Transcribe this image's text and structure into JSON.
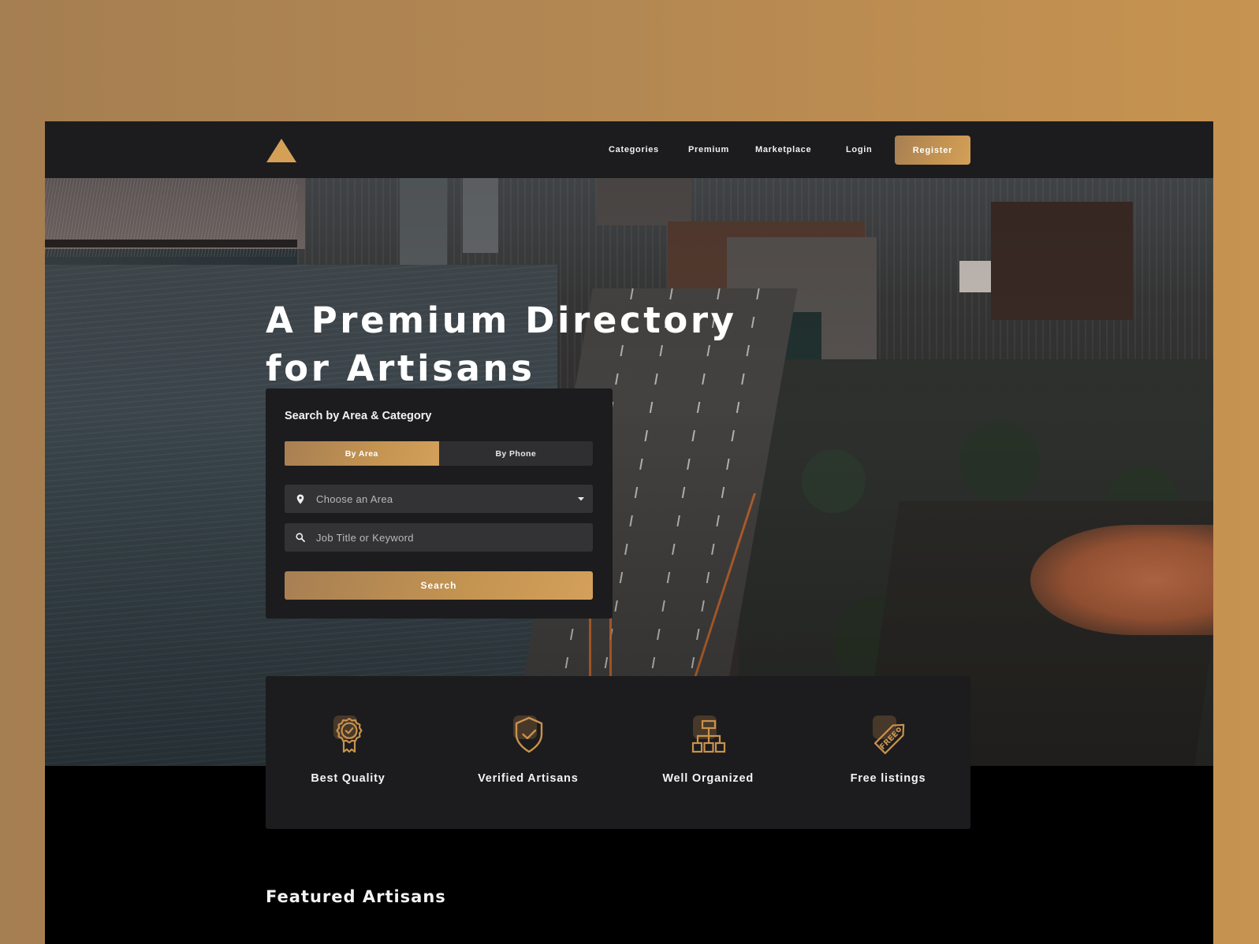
{
  "colors": {
    "accent": "#c49451",
    "accent_dark": "#a77f53",
    "panel": "#1c1c1e",
    "input": "#333335",
    "page_background": "#b48852"
  },
  "navbar": {
    "logo": "triangle-logo-icon",
    "links": [
      {
        "label": "Categories"
      },
      {
        "label": "Premium"
      },
      {
        "label": "Marketplace"
      },
      {
        "label": "Login"
      }
    ],
    "register_label": "Register"
  },
  "hero": {
    "title_line1": "A Premium Directory",
    "title_line2": "for Artisans",
    "background": "aerial-city-highway-photo"
  },
  "search": {
    "title": "Search by Area & Category",
    "tabs": [
      {
        "label": "By Area",
        "active": true
      },
      {
        "label": "By Phone",
        "active": false
      }
    ],
    "area_select": {
      "icon": "map-pin-icon",
      "placeholder": "Choose an Area",
      "value": ""
    },
    "keyword_input": {
      "icon": "search-icon",
      "placeholder": "Job Title or Keyword",
      "value": ""
    },
    "submit_label": "Search"
  },
  "features": [
    {
      "icon": "award-badge-icon",
      "label": "Best Quality"
    },
    {
      "icon": "shield-check-icon",
      "label": "Verified Artisans"
    },
    {
      "icon": "org-chart-icon",
      "label": "Well Organized"
    },
    {
      "icon": "free-tag-icon",
      "label": "Free listings"
    }
  ],
  "featured": {
    "title": "Featured Artisans"
  }
}
